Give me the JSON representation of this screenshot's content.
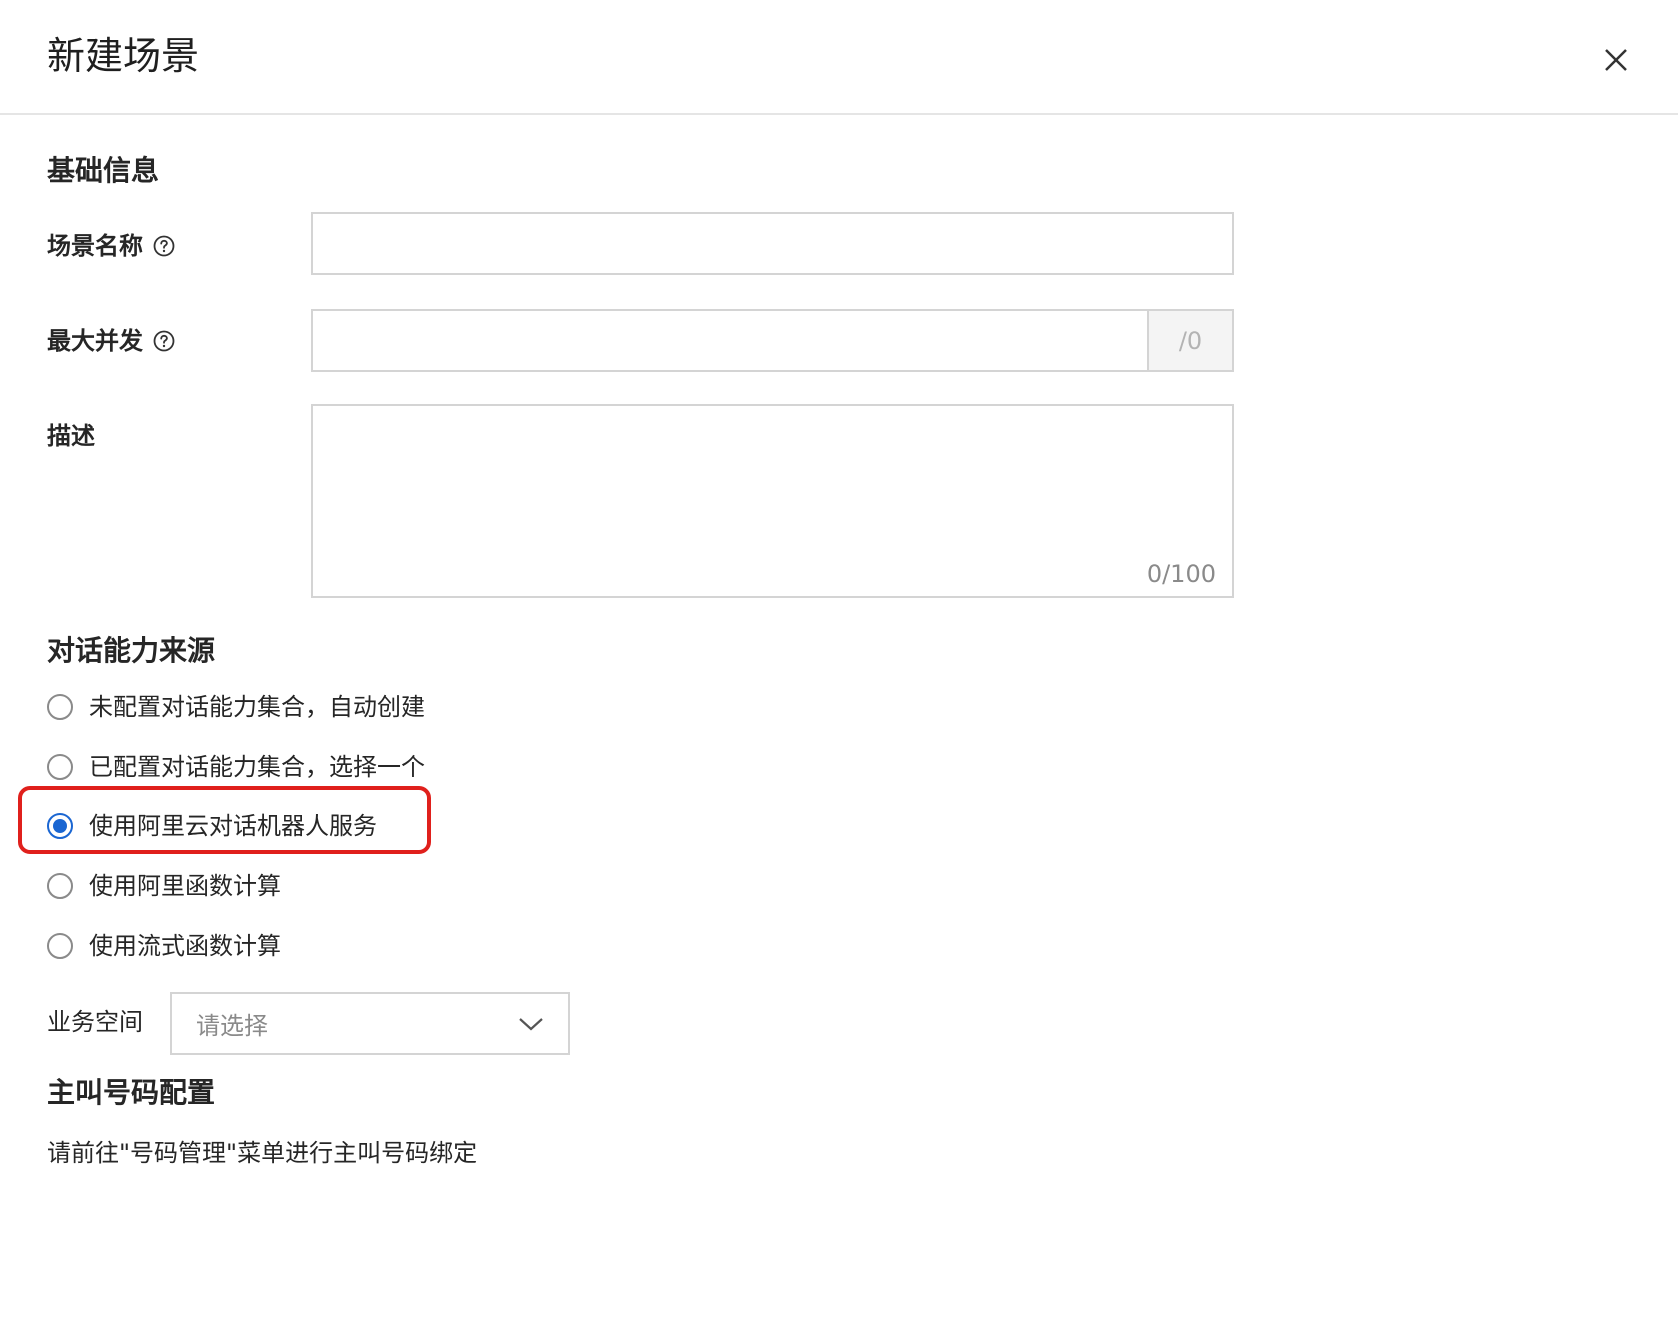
{
  "dialog": {
    "title": "新建场景",
    "close_icon": "close-icon"
  },
  "basic_info": {
    "heading": "基础信息",
    "scene_name": {
      "label": "场景名称",
      "value": "",
      "help_icon": "question-circle-icon"
    },
    "max_concurrency": {
      "label": "最大并发",
      "value": "",
      "suffix": "/0",
      "help_icon": "question-circle-icon"
    },
    "description": {
      "label": "描述",
      "value": "",
      "counter": "0/100"
    }
  },
  "dialog_source": {
    "heading": "对话能力来源",
    "options": [
      {
        "label": "未配置对话能力集合，自动创建",
        "checked": false
      },
      {
        "label": "已配置对话能力集合，选择一个",
        "checked": false
      },
      {
        "label": "使用阿里云对话机器人服务",
        "checked": true
      },
      {
        "label": "使用阿里函数计算",
        "checked": false
      },
      {
        "label": "使用流式函数计算",
        "checked": false
      }
    ],
    "highlight_color": "#e0201c",
    "accent_color": "#1a66d2"
  },
  "workspace": {
    "label": "业务空间",
    "placeholder": "请选择",
    "icon": "chevron-down-icon"
  },
  "caller_config": {
    "heading": "主叫号码配置",
    "note": "请前往\"号码管理\"菜单进行主叫号码绑定"
  }
}
